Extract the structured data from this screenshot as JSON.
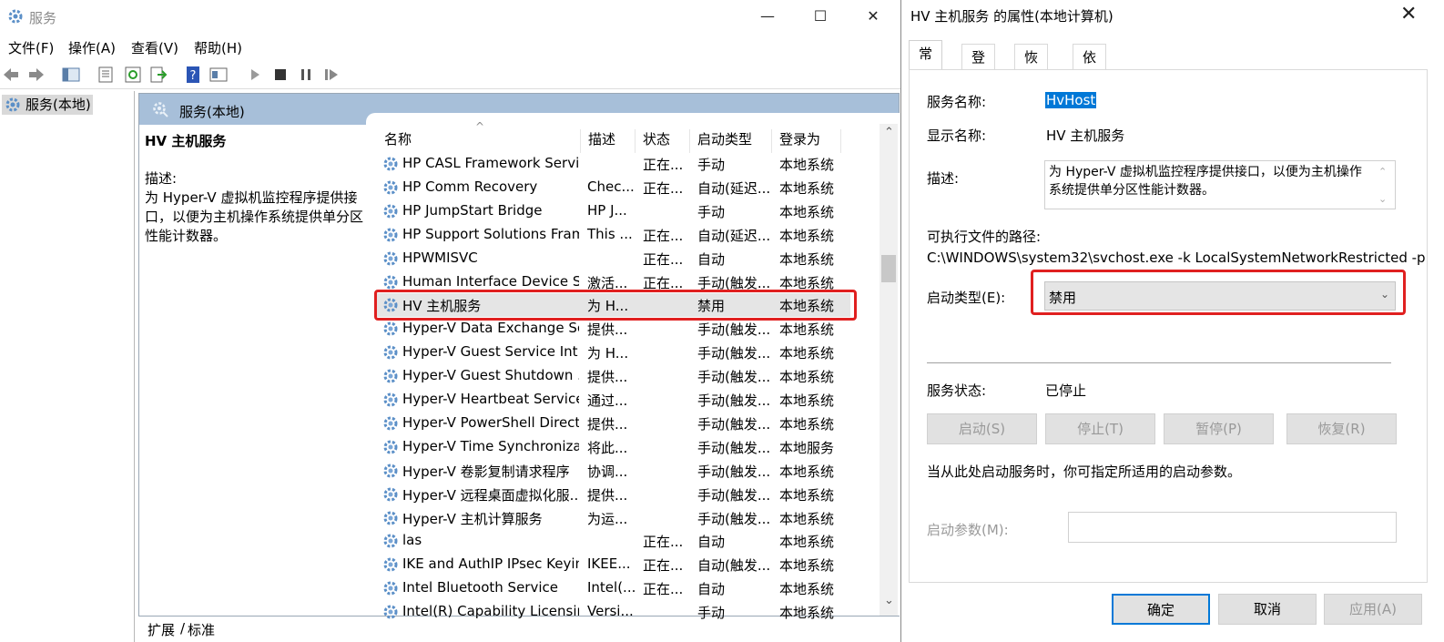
{
  "window": {
    "title": "服务",
    "min": "—",
    "max": "☐",
    "close": "✕"
  },
  "menu": [
    "文件(F)",
    "操作(A)",
    "查看(V)",
    "帮助(H)"
  ],
  "tree": {
    "item": "服务(本地)"
  },
  "content_header": "服务(本地)",
  "detail": {
    "title": "HV 主机服务",
    "desc_label": "描述:",
    "desc": "为 Hyper-V 虚拟机监控程序提供接口，以便为主机操作系统提供单分区性能计数器。"
  },
  "columns": [
    "名称",
    "描述",
    "状态",
    "启动类型",
    "登录为"
  ],
  "sort_indicator": "^",
  "rows": [
    {
      "name": "HP CASL Framework Service",
      "desc": "",
      "status": "正在...",
      "startup": "手动",
      "logon": "本地系统"
    },
    {
      "name": "HP Comm Recovery",
      "desc": "Chec...",
      "status": "正在...",
      "startup": "自动(延迟...",
      "logon": "本地系统"
    },
    {
      "name": "HP JumpStart Bridge",
      "desc": "HP J...",
      "status": "",
      "startup": "手动",
      "logon": "本地系统"
    },
    {
      "name": "HP Support Solutions Fram...",
      "desc": "This ...",
      "status": "正在...",
      "startup": "自动(延迟...",
      "logon": "本地系统"
    },
    {
      "name": "HPWMISVC",
      "desc": "",
      "status": "正在...",
      "startup": "自动",
      "logon": "本地系统"
    },
    {
      "name": "Human Interface Device S...",
      "desc": "激活...",
      "status": "正在...",
      "startup": "手动(触发...",
      "logon": "本地系统"
    },
    {
      "name": "HV 主机服务",
      "desc": "为 H...",
      "status": "",
      "startup": "禁用",
      "logon": "本地系统"
    },
    {
      "name": "Hyper-V Data Exchange Se...",
      "desc": "提供...",
      "status": "",
      "startup": "手动(触发...",
      "logon": "本地系统"
    },
    {
      "name": "Hyper-V Guest Service Int...",
      "desc": "为 H...",
      "status": "",
      "startup": "手动(触发...",
      "logon": "本地系统"
    },
    {
      "name": "Hyper-V Guest Shutdown ...",
      "desc": "提供...",
      "status": "",
      "startup": "手动(触发...",
      "logon": "本地系统"
    },
    {
      "name": "Hyper-V Heartbeat Service",
      "desc": "通过...",
      "status": "",
      "startup": "手动(触发...",
      "logon": "本地系统"
    },
    {
      "name": "Hyper-V PowerShell Direct...",
      "desc": "提供...",
      "status": "",
      "startup": "手动(触发...",
      "logon": "本地系统"
    },
    {
      "name": "Hyper-V Time Synchroniza...",
      "desc": "将此...",
      "status": "",
      "startup": "手动(触发...",
      "logon": "本地服务"
    },
    {
      "name": "Hyper-V 卷影复制请求程序",
      "desc": "协调...",
      "status": "",
      "startup": "手动(触发...",
      "logon": "本地系统"
    },
    {
      "name": "Hyper-V 远程桌面虚拟化服...",
      "desc": "提供...",
      "status": "",
      "startup": "手动(触发...",
      "logon": "本地系统"
    },
    {
      "name": "Hyper-V 主机计算服务",
      "desc": "为运...",
      "status": "",
      "startup": "手动(触发...",
      "logon": "本地系统"
    },
    {
      "name": "las",
      "desc": "",
      "status": "正在...",
      "startup": "自动",
      "logon": "本地系统"
    },
    {
      "name": "IKE and AuthIP IPsec Keyin...",
      "desc": "IKEE...",
      "status": "正在...",
      "startup": "自动(触发...",
      "logon": "本地系统"
    },
    {
      "name": "Intel Bluetooth Service",
      "desc": "Intel(...",
      "status": "正在...",
      "startup": "自动",
      "logon": "本地系统"
    },
    {
      "name": "Intel(R) Capability Licensin...",
      "desc": "Versi...",
      "status": "",
      "startup": "手动",
      "logon": "本地系统"
    }
  ],
  "bottom_tabs": [
    "扩展",
    "标准"
  ],
  "dialog": {
    "title": "HV 主机服务 的属性(本地计算机)",
    "close": "✕",
    "tabs": [
      "常规",
      "登录",
      "恢复",
      "依存关系"
    ],
    "service_name_label": "服务名称:",
    "service_name": "HvHost",
    "display_name_label": "显示名称:",
    "display_name": "HV 主机服务",
    "desc_label": "描述:",
    "desc": "为 Hyper-V 虚拟机监控程序提供接口，以便为主机操作系统提供单分区性能计数器。",
    "path_label": "可执行文件的路径:",
    "path": "C:\\WINDOWS\\system32\\svchost.exe -k LocalSystemNetworkRestricted -p",
    "startup_label": "启动类型(E):",
    "startup_value": "禁用",
    "status_label": "服务状态:",
    "status_value": "已停止",
    "btn_start": "启动(S)",
    "btn_stop": "停止(T)",
    "btn_pause": "暂停(P)",
    "btn_resume": "恢复(R)",
    "hint": "当从此处启动服务时，你可指定所适用的启动参数。",
    "params_label": "启动参数(M):",
    "params_value": "",
    "ok": "确定",
    "cancel": "取消",
    "apply": "应用(A)"
  },
  "colors": {
    "accent": "#a7bfd9",
    "highlight": "#e02020",
    "selection": "#0078d7"
  }
}
